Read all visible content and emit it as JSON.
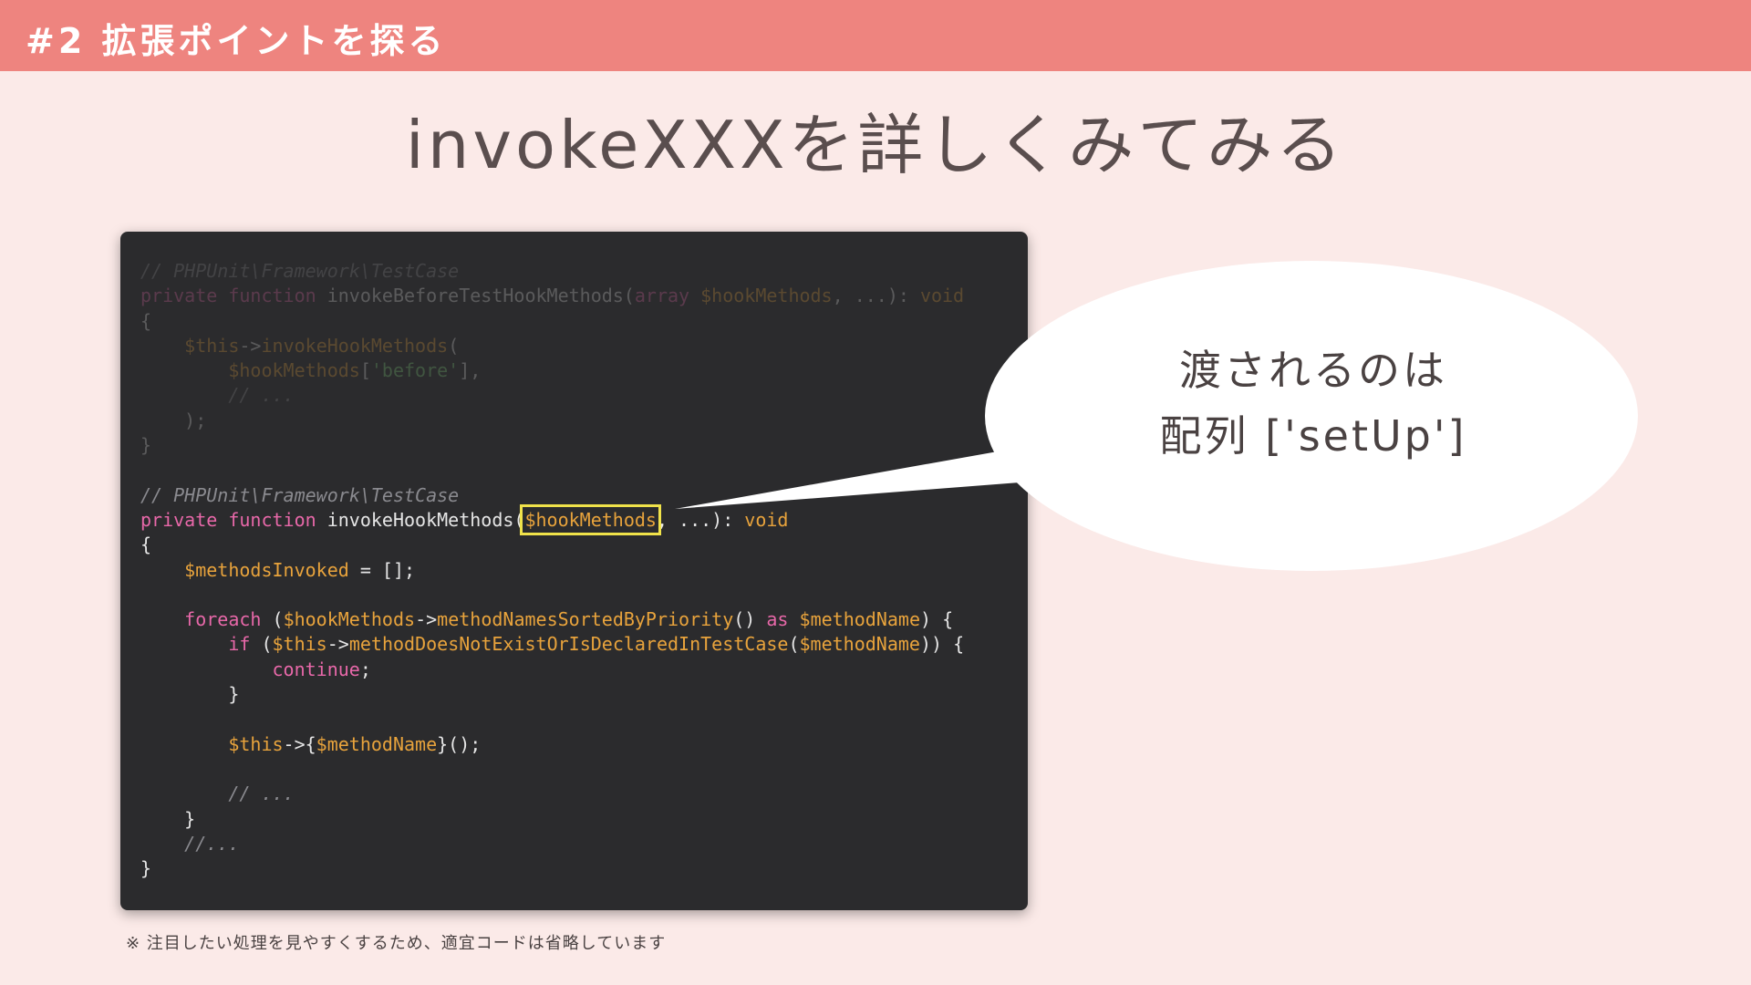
{
  "header": {
    "title": "#2 拡張ポイントを探る"
  },
  "slide": {
    "title": "invokeXXXを詳しくみてみる",
    "footnote": "※ 注目したい処理を見やすくするため、適宜コードは省略しています"
  },
  "bubble": {
    "line1": "渡されるのは",
    "line2": "配列 ['setUp']"
  },
  "colors": {
    "header_bg": "#EE847F",
    "page_bg": "#FBEAE8",
    "code_bg": "#2B2B2D",
    "keyword": "#E868A9",
    "variable": "#E8A33C",
    "string": "#7FD17A",
    "comment": "#8A8A8F",
    "highlight": "#F0E24A"
  },
  "code": {
    "lines": [
      {
        "dim": true,
        "tokens": [
          {
            "t": "comment",
            "v": "// PHPUnit\\Framework\\TestCase"
          }
        ]
      },
      {
        "dim": true,
        "tokens": [
          {
            "t": "kw",
            "v": "private function "
          },
          {
            "t": "plain",
            "v": "invokeBeforeTestHookMethods("
          },
          {
            "t": "kw",
            "v": "array "
          },
          {
            "t": "var",
            "v": "$hookMethods"
          },
          {
            "t": "plain",
            "v": ", ...): "
          },
          {
            "t": "type",
            "v": "void"
          }
        ]
      },
      {
        "dim": true,
        "tokens": [
          {
            "t": "plain",
            "v": "{"
          }
        ]
      },
      {
        "dim": true,
        "tokens": [
          {
            "t": "plain",
            "v": "    "
          },
          {
            "t": "var",
            "v": "$this"
          },
          {
            "t": "plain",
            "v": "->"
          },
          {
            "t": "method",
            "v": "invokeHookMethods"
          },
          {
            "t": "plain",
            "v": "("
          }
        ]
      },
      {
        "dim": true,
        "tokens": [
          {
            "t": "plain",
            "v": "        "
          },
          {
            "t": "var",
            "v": "$hookMethods"
          },
          {
            "t": "plain",
            "v": "["
          },
          {
            "t": "str",
            "v": "'before'"
          },
          {
            "t": "plain",
            "v": "],"
          }
        ]
      },
      {
        "dim": true,
        "tokens": [
          {
            "t": "plain",
            "v": "        "
          },
          {
            "t": "comment",
            "v": "// ..."
          }
        ]
      },
      {
        "dim": true,
        "tokens": [
          {
            "t": "plain",
            "v": "    );"
          }
        ]
      },
      {
        "dim": true,
        "tokens": [
          {
            "t": "plain",
            "v": "}"
          }
        ]
      },
      {
        "dim": false,
        "tokens": [
          {
            "t": "plain",
            "v": ""
          }
        ]
      },
      {
        "dim": false,
        "tokens": [
          {
            "t": "comment",
            "v": "// PHPUnit\\Framework\\TestCase"
          }
        ]
      },
      {
        "dim": false,
        "tokens": [
          {
            "t": "kw",
            "v": "private function "
          },
          {
            "t": "plain",
            "v": "invokeHookMethods("
          },
          {
            "t": "var",
            "v": "$hookMethods",
            "hl": true
          },
          {
            "t": "plain",
            "v": ", ...): "
          },
          {
            "t": "type",
            "v": "void"
          }
        ]
      },
      {
        "dim": false,
        "tokens": [
          {
            "t": "plain",
            "v": "{"
          }
        ]
      },
      {
        "dim": false,
        "tokens": [
          {
            "t": "plain",
            "v": "    "
          },
          {
            "t": "var",
            "v": "$methodsInvoked"
          },
          {
            "t": "plain",
            "v": " = [];"
          }
        ]
      },
      {
        "dim": false,
        "tokens": [
          {
            "t": "plain",
            "v": ""
          }
        ]
      },
      {
        "dim": false,
        "tokens": [
          {
            "t": "plain",
            "v": "    "
          },
          {
            "t": "kw",
            "v": "foreach"
          },
          {
            "t": "plain",
            "v": " ("
          },
          {
            "t": "var",
            "v": "$hookMethods"
          },
          {
            "t": "plain",
            "v": "->"
          },
          {
            "t": "method",
            "v": "methodNamesSortedByPriority"
          },
          {
            "t": "plain",
            "v": "() "
          },
          {
            "t": "kw",
            "v": "as"
          },
          {
            "t": "plain",
            "v": " "
          },
          {
            "t": "var",
            "v": "$methodName"
          },
          {
            "t": "plain",
            "v": ") {"
          }
        ]
      },
      {
        "dim": false,
        "tokens": [
          {
            "t": "plain",
            "v": "        "
          },
          {
            "t": "kw",
            "v": "if"
          },
          {
            "t": "plain",
            "v": " ("
          },
          {
            "t": "var",
            "v": "$this"
          },
          {
            "t": "plain",
            "v": "->"
          },
          {
            "t": "method",
            "v": "methodDoesNotExistOrIsDeclaredInTestCase"
          },
          {
            "t": "plain",
            "v": "("
          },
          {
            "t": "var",
            "v": "$methodName"
          },
          {
            "t": "plain",
            "v": ")) {"
          }
        ]
      },
      {
        "dim": false,
        "tokens": [
          {
            "t": "plain",
            "v": "            "
          },
          {
            "t": "kw",
            "v": "continue"
          },
          {
            "t": "plain",
            "v": ";"
          }
        ]
      },
      {
        "dim": false,
        "tokens": [
          {
            "t": "plain",
            "v": "        }"
          }
        ]
      },
      {
        "dim": false,
        "tokens": [
          {
            "t": "plain",
            "v": ""
          }
        ]
      },
      {
        "dim": false,
        "tokens": [
          {
            "t": "plain",
            "v": "        "
          },
          {
            "t": "var",
            "v": "$this"
          },
          {
            "t": "plain",
            "v": "->{"
          },
          {
            "t": "var",
            "v": "$methodName"
          },
          {
            "t": "plain",
            "v": "}();"
          }
        ]
      },
      {
        "dim": false,
        "tokens": [
          {
            "t": "plain",
            "v": ""
          }
        ]
      },
      {
        "dim": false,
        "tokens": [
          {
            "t": "plain",
            "v": "        "
          },
          {
            "t": "comment",
            "v": "// ..."
          }
        ]
      },
      {
        "dim": false,
        "tokens": [
          {
            "t": "plain",
            "v": "    }"
          }
        ]
      },
      {
        "dim": false,
        "tokens": [
          {
            "t": "plain",
            "v": "    "
          },
          {
            "t": "comment",
            "v": "//..."
          }
        ]
      },
      {
        "dim": false,
        "tokens": [
          {
            "t": "plain",
            "v": "}"
          }
        ]
      }
    ]
  }
}
